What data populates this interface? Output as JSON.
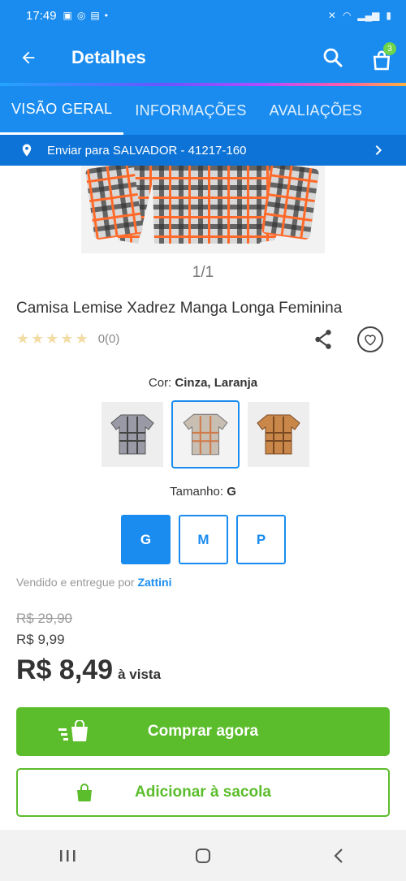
{
  "status": {
    "time": "17:49"
  },
  "header": {
    "title": "Detalhes",
    "cart_count": "3"
  },
  "tabs": [
    {
      "label": "VISÃO GERAL",
      "active": true
    },
    {
      "label": "INFORMAÇÕES",
      "active": false
    },
    {
      "label": "AVALIAÇÕES",
      "active": false
    }
  ],
  "shipping": {
    "text": "Enviar para SALVADOR - 41217-160"
  },
  "gallery": {
    "pager": "1/1"
  },
  "product": {
    "title": "Camisa Lemise Xadrez Manga Longa Feminina",
    "rating": "0(0)"
  },
  "color": {
    "label": "Cor:",
    "value": "Cinza, Laranja"
  },
  "size": {
    "label": "Tamanho:",
    "value": "G",
    "options": [
      "G",
      "M",
      "P"
    ],
    "selected": "G"
  },
  "seller": {
    "prefix": "Vendido e entregue por",
    "name": "Zattini"
  },
  "price": {
    "old": "R$ 29,90",
    "secondary": "R$ 9,99",
    "main": "R$ 8,49",
    "suffix": "à vista"
  },
  "buttons": {
    "buy": "Comprar agora",
    "add_to_bag": "Adicionar à sacola"
  },
  "colors": {
    "primary": "#1a8cf0",
    "dark_blue": "#0d73d6",
    "green": "#5bbd2b",
    "badge": "#6dd44b"
  }
}
